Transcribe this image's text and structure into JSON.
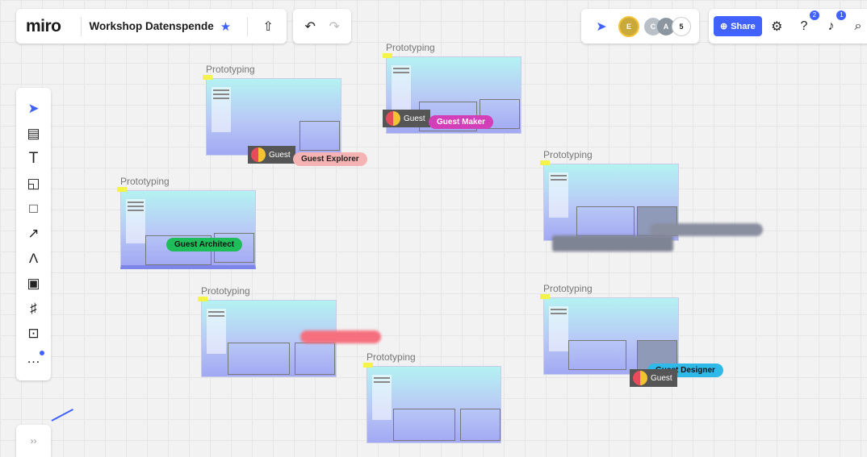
{
  "app": {
    "logo": "miro",
    "board_title": "Workshop Datenspende"
  },
  "header": {
    "upload_icon": "upload-icon",
    "undo_icon": "undo-icon",
    "redo_icon": "redo-icon",
    "collaborators": {
      "avatars": [
        "E",
        "C",
        "A"
      ],
      "extra_count": "5"
    },
    "share_label": "Share",
    "help_badge": "2",
    "notifications_badge": "1"
  },
  "toolbar": {
    "tools": [
      "select-cursor-icon",
      "frame-template-icon",
      "text-icon",
      "sticky-note-icon",
      "shape-icon",
      "arrow-icon",
      "pen-icon",
      "comment-icon",
      "frame-icon",
      "upload-icon",
      "more-icon"
    ]
  },
  "frames": [
    {
      "title": "Prototyping"
    },
    {
      "title": "Prototyping"
    },
    {
      "title": "Prototyping"
    },
    {
      "title": "Prototyping"
    },
    {
      "title": "Prototyping"
    },
    {
      "title": "Prototyping"
    },
    {
      "title": "Prototyping"
    }
  ],
  "cursors": {
    "explorer": "Guest Explorer",
    "maker": "Guest Maker",
    "architect": "Guest Architect",
    "designer": "Guest Designer",
    "guest_label": "Guest"
  },
  "collapse_label": "››",
  "colors": {
    "accent": "#4262ff"
  }
}
